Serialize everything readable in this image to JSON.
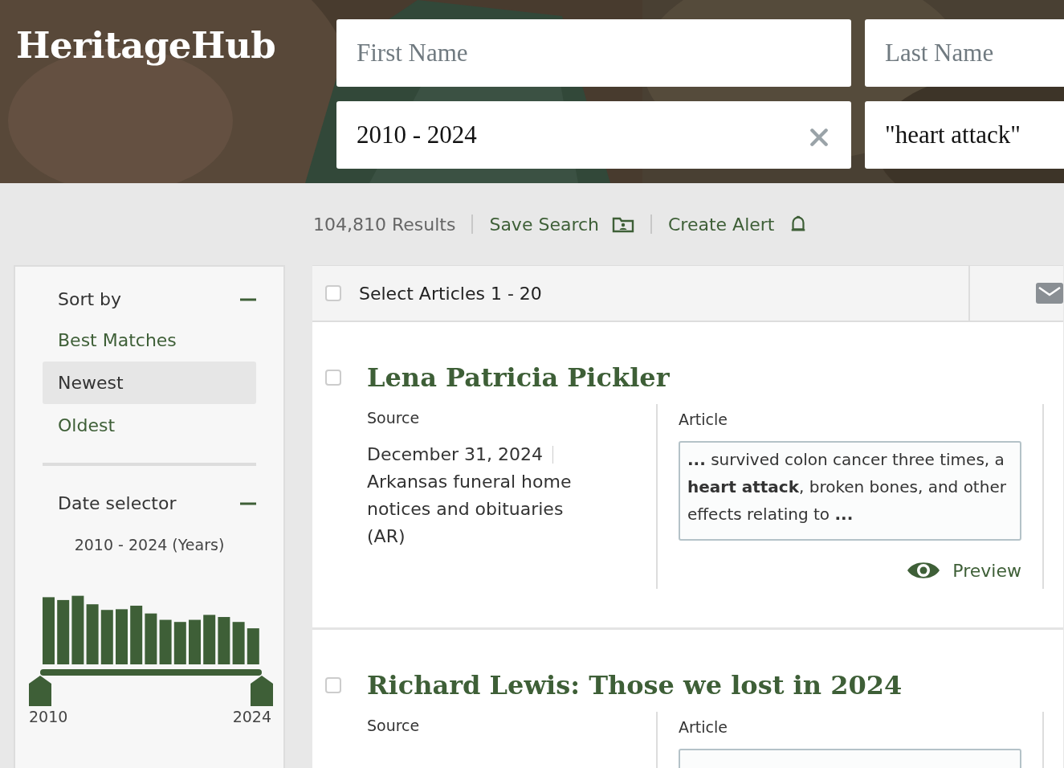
{
  "logo": "HeritageHub",
  "search_fields": [
    {
      "placeholder": "First Name"
    },
    {
      "placeholder": "Last Name"
    },
    {
      "value": "2010 - 2024",
      "clearable": true
    },
    {
      "value": "\"heart attack\"",
      "clearable": false
    }
  ],
  "results_bar": {
    "count": "104,810 Results",
    "actions": [
      {
        "label": "Save Search"
      },
      {
        "label": "Create Alert"
      }
    ]
  },
  "sidebar": {
    "sort": {
      "title": "Sort by",
      "expanded": true,
      "options": [
        {
          "label": "Best Matches",
          "selected": false
        },
        {
          "label": "Newest",
          "selected": true
        },
        {
          "label": "Oldest",
          "selected": false
        }
      ]
    },
    "date": {
      "title": "Date selector",
      "expanded": true,
      "range_label": "2010 - 2024 (Years)",
      "handles": [
        {
          "level": 0
        },
        {
          "level": 1
        }
      ],
      "min_label": "2010",
      "max_label": "2024"
    }
  },
  "list_header": {
    "label": "Select Articles 1 - 20",
    "checked": false
  },
  "results": [
    {
      "title": "Lena Patricia Pickler",
      "checked": false,
      "source_heading": "Source",
      "date": "December 31, 2024",
      "source": "Arkansas funeral home notices and obituaries (AR)",
      "article_heading": "Article",
      "snippet": "**...** survived colon cancer three times, a **heart attack**, broken bones, and other effects relating to **...**",
      "preview": "Preview"
    },
    {
      "title": "Richard Lewis: Those we lost in 2024",
      "checked": false,
      "source_heading": "Source",
      "article_heading": "Article"
    }
  ]
}
